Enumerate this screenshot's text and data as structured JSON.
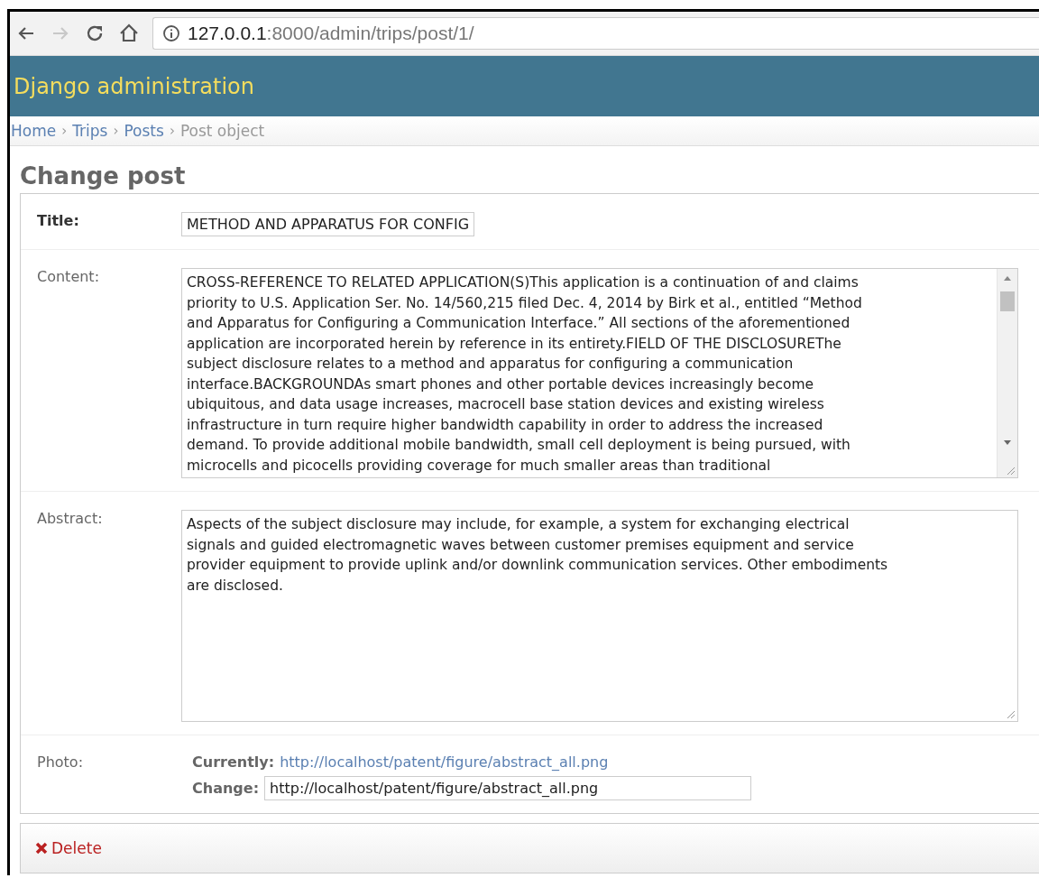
{
  "browser": {
    "url_host": "127.0.0.1",
    "url_path": ":8000/admin/trips/post/1/",
    "back_disabled": false,
    "forward_disabled": true
  },
  "header": {
    "title": "Django administration"
  },
  "breadcrumbs": [
    {
      "label": "Home",
      "link": true
    },
    {
      "label": "Trips",
      "link": true
    },
    {
      "label": "Posts",
      "link": true
    },
    {
      "label": "Post object",
      "link": false
    }
  ],
  "separator": "›",
  "heading": "Change post",
  "fields": [
    {
      "kind": "text",
      "label": "Title:",
      "required": true,
      "value": "METHOD AND APPARATUS FOR CONFIG"
    },
    {
      "kind": "textarea",
      "label": "Content:",
      "required": false,
      "scrollbar": true,
      "lines": [
        "CROSS-REFERENCE TO RELATED APPLICATION(S)This application is a continuation of and claims",
        "priority to U.S. Application Ser. No. 14/560,215 filed Dec. 4, 2014 by Birk et al., entitled “Method",
        "and Apparatus for Configuring a Communication Interface.” All sections of the aforementioned",
        "application are incorporated herein by reference in its entirety.FIELD OF THE DISCLOSUREThe",
        "subject disclosure relates to a method and apparatus for configuring a communication",
        "interface.BACKGROUNDAs smart phones and other portable devices increasingly become",
        "ubiquitous, and data usage increases, macrocell base station devices and existing wireless",
        "infrastructure in turn require higher bandwidth capability in order to address the increased",
        "demand. To provide additional mobile bandwidth, small cell deployment is being pursued, with",
        "microcells and picocells providing coverage for much smaller areas than traditional"
      ]
    },
    {
      "kind": "textarea",
      "label": "Abstract:",
      "required": false,
      "scrollbar": false,
      "lines": [
        "Aspects of the subject disclosure may include, for example, a system for exchanging electrical",
        "signals and guided electromagnetic waves between customer premises equipment and service",
        "provider equipment to provide uplink and/or downlink communication services. Other embodiments",
        "are disclosed."
      ]
    },
    {
      "kind": "file",
      "label": "Photo:",
      "required": false,
      "currently_label": "Currently:",
      "currently_link": "http://localhost/patent/figure/abstract_all.png",
      "change_label": "Change:",
      "value": "http://localhost/patent/figure/abstract_all.png"
    }
  ],
  "delete_link": "Delete"
}
